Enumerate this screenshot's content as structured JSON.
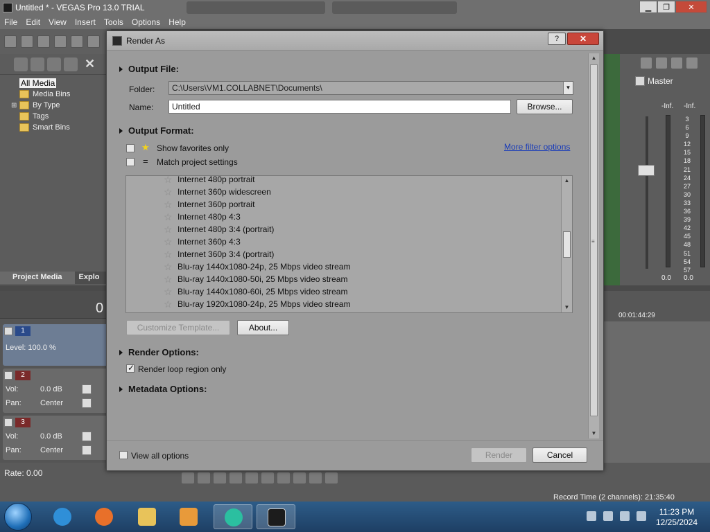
{
  "app": {
    "title": "Untitled * - VEGAS Pro 13.0 TRIAL",
    "menu": [
      "File",
      "Edit",
      "View",
      "Insert",
      "Tools",
      "Options",
      "Help"
    ]
  },
  "explorer": {
    "tree": [
      "All Media",
      "Media Bins",
      "By Type",
      "Tags",
      "Smart Bins"
    ],
    "tabs": [
      "Project Media",
      "Explo"
    ]
  },
  "tracks": {
    "level": "Level: 100.0 %",
    "track1_num": "1",
    "track2_num": "2",
    "track3_num": "3",
    "vol_label": "Vol:",
    "vol_value": "0.0 dB",
    "pan_label": "Pan:",
    "pan_value": "Center",
    "time_partial": "0"
  },
  "mixer": {
    "master_label": "Master",
    "inf_left": "-Inf.",
    "inf_right": "-Inf.",
    "scale": [
      "3",
      "6",
      "9",
      "12",
      "15",
      "18",
      "21",
      "24",
      "27",
      "30",
      "33",
      "36",
      "39",
      "42",
      "45",
      "48",
      "51",
      "54",
      "57"
    ],
    "bottom_left": "0.0",
    "bottom_right": "0.0"
  },
  "timeline": {
    "timecode": "00:01:44:29"
  },
  "status": {
    "rate": "Rate: 0.00",
    "record_time": "Record Time (2 channels): 21:35:40"
  },
  "dialog": {
    "title": "Render As",
    "help_label": "?",
    "close_label": "✕",
    "output_file": {
      "header": "Output File:",
      "folder_label": "Folder:",
      "folder_value": "C:\\Users\\VM1.COLLABNET\\Documents\\",
      "name_label": "Name:",
      "name_value": "Untitled",
      "browse_label": "Browse..."
    },
    "output_format": {
      "header": "Output Format:",
      "show_favorites_label": "Show favorites only",
      "match_project_label": "Match project settings",
      "more_filter_label": "More filter options",
      "templates": [
        "Internet 480p portrait",
        "Internet 360p widescreen",
        "Internet 360p portrait",
        "Internet 480p 4:3",
        "Internet 480p 3:4 (portrait)",
        "Internet 360p 4:3",
        "Internet 360p 3:4 (portrait)",
        "Blu-ray 1440x1080-24p, 25 Mbps video stream",
        "Blu-ray 1440x1080-50i, 25 Mbps video stream",
        "Blu-ray 1440x1080-60i, 25 Mbps video stream",
        "Blu-ray 1920x1080-24p, 25 Mbps video stream"
      ],
      "customize_label": "Customize Template...",
      "about_label": "About..."
    },
    "render_options": {
      "header": "Render Options:",
      "loop_region_label": "Render loop region only",
      "loop_region_checked": true
    },
    "metadata_options": {
      "header": "Metadata Options:"
    },
    "footer": {
      "view_all_label": "View all options",
      "render_label": "Render",
      "cancel_label": "Cancel"
    }
  },
  "taskbar": {
    "time": "11:23 PM",
    "date": "12/25/2024"
  },
  "colors": {
    "dialog_bg": "#9b9b9b",
    "link": "#1a3cb8",
    "close_button": "#c9463a",
    "taskbar": "#1e3f64"
  }
}
